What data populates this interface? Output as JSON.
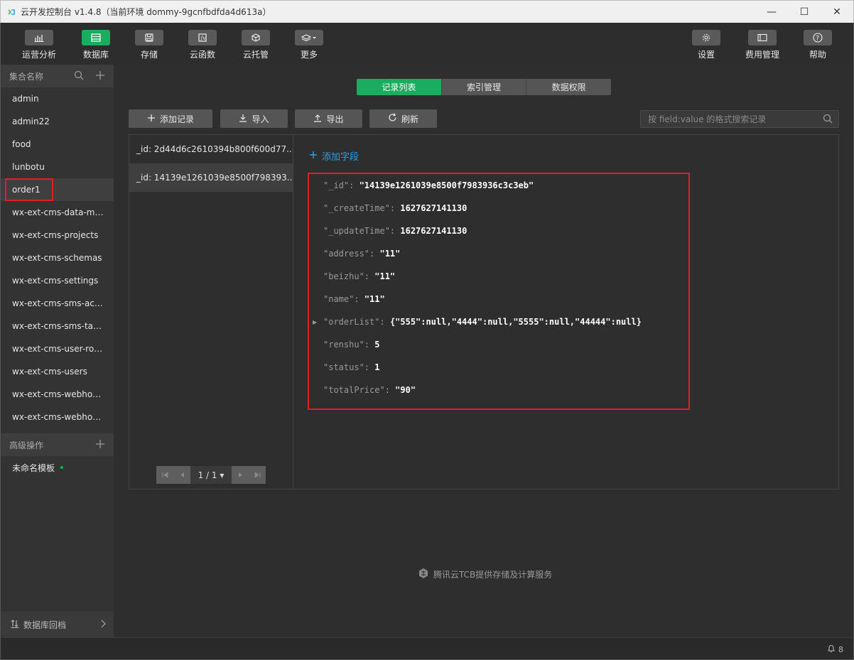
{
  "window": {
    "title": "云开发控制台 v1.4.8（当前环境 dommy-9gcnfbdfda4d613a）",
    "minimize": "—",
    "maximize": "☐",
    "close": "✕"
  },
  "toolbar": {
    "left": [
      {
        "label": "运营分析",
        "icon": "bar-chart-icon"
      },
      {
        "label": "数据库",
        "icon": "database-icon",
        "active": true
      },
      {
        "label": "存储",
        "icon": "storage-icon"
      },
      {
        "label": "云函数",
        "icon": "function-icon"
      },
      {
        "label": "云托管",
        "icon": "cube-icon"
      },
      {
        "label": "更多",
        "icon": "layers-icon"
      }
    ],
    "right": [
      {
        "label": "设置",
        "icon": "gear-icon"
      },
      {
        "label": "费用管理",
        "icon": "billing-icon"
      },
      {
        "label": "帮助",
        "icon": "help-icon"
      }
    ]
  },
  "sidebar": {
    "collections_header": "集合名称",
    "collections": [
      "admin",
      "admin22",
      "food",
      "lunbotu",
      "order1",
      "wx-ext-cms-data-migr...",
      "wx-ext-cms-projects",
      "wx-ext-cms-schemas",
      "wx-ext-cms-settings",
      "wx-ext-cms-sms-activi...",
      "wx-ext-cms-sms-tasks",
      "wx-ext-cms-user-roles",
      "wx-ext-cms-users",
      "wx-ext-cms-webhook...",
      "wx-ext-cms-webhooks"
    ],
    "selected_collection": "order1",
    "advanced_header": "高级操作",
    "template_item": "未命名模板",
    "footer": "数据库回档"
  },
  "tabs": [
    "记录列表",
    "索引管理",
    "数据权限"
  ],
  "active_tab": "记录列表",
  "actions": {
    "add_record": "添加记录",
    "import": "导入",
    "export": "导出",
    "refresh": "刷新"
  },
  "search": {
    "placeholder": "按 field:value 的格式搜索记录"
  },
  "records": [
    "_id: 2d44d6c2610394b800f600d77...",
    "_id: 14139e1261039e8500f798393..."
  ],
  "selected_record_index": 1,
  "pager": {
    "text": "1 / 1 ▾"
  },
  "detail": {
    "add_field": "添加字段",
    "fields": [
      {
        "key": "\"_id\"",
        "value": "\"14139e1261039e8500f7983936c3c3eb\""
      },
      {
        "key": "\"_createTime\"",
        "value": "1627627141130"
      },
      {
        "key": "\"_updateTime\"",
        "value": "1627627141130"
      },
      {
        "key": "\"address\"",
        "value": "\"11\""
      },
      {
        "key": "\"beizhu\"",
        "value": "\"11\""
      },
      {
        "key": "\"name\"",
        "value": "\"11\""
      },
      {
        "key": "\"orderList\"",
        "value": "{\"555\":null,\"4444\":null,\"5555\":null,\"44444\":null}",
        "expandable": true
      },
      {
        "key": "\"renshu\"",
        "value": "5"
      },
      {
        "key": "\"status\"",
        "value": "1"
      },
      {
        "key": "\"totalPrice\"",
        "value": "\"90\""
      }
    ]
  },
  "footer_note": "腾讯云TCB提供存储及计算服务",
  "status": {
    "notification_count": "8"
  }
}
